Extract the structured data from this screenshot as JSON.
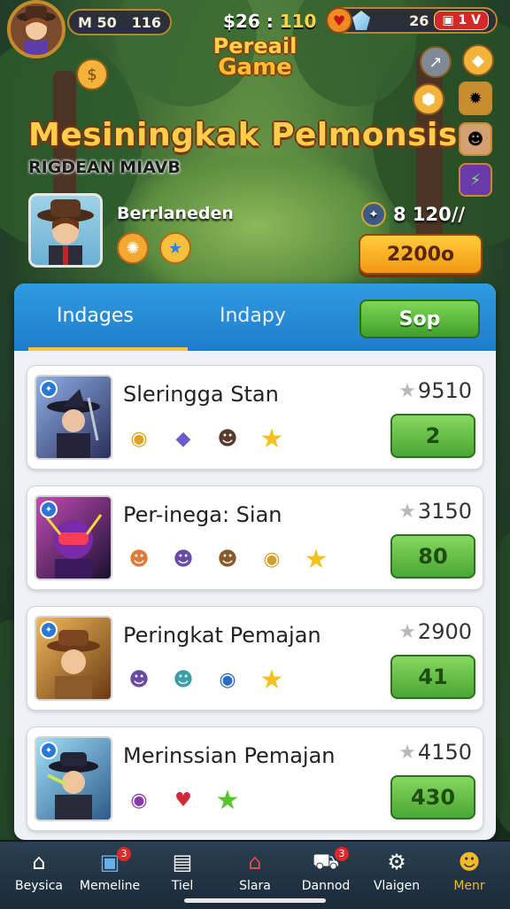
{
  "header": {
    "left_pill_label": "M 50",
    "left_pill_value": "116",
    "money_prefix": "$26 :",
    "money_value": "110",
    "gems_value": "26",
    "right_badge": "1 V"
  },
  "logo": {
    "line1": "Pereail",
    "line2": "Game"
  },
  "title": "Mesiningkak Pelmonsis",
  "subtitle": "RIGDEAN MIAVB",
  "player": {
    "name": "Berrlaneden",
    "stat_value": "8 120//",
    "gold_button": "2200o"
  },
  "tabs": {
    "tab1": "Indages",
    "tab2": "Indapy",
    "action_button": "Sop"
  },
  "rows": [
    {
      "name": "Sleringga Stan",
      "score": "9510",
      "button": "2",
      "thumb_colors": [
        "#6b8fd4",
        "#2a2f5a"
      ]
    },
    {
      "name": "Per-inega: Sian",
      "score": "3150",
      "button": "80",
      "thumb_colors": [
        "#b23aa8",
        "#1a1030"
      ]
    },
    {
      "name": "Peringkat Pemajan",
      "score": "2900",
      "button": "41",
      "thumb_colors": [
        "#e0a24a",
        "#6a3a14"
      ]
    },
    {
      "name": "Merinssian Pemajan",
      "score": "4150",
      "button": "430",
      "thumb_colors": [
        "#7ad0f0",
        "#2e5a8a"
      ]
    }
  ],
  "nav": [
    {
      "label": "Beysica",
      "icon": "home-icon"
    },
    {
      "label": "Memeline",
      "icon": "gift-icon",
      "badge": "3"
    },
    {
      "label": "Tiel",
      "icon": "card-icon"
    },
    {
      "label": "Slara",
      "icon": "shop-icon"
    },
    {
      "label": "Dannod",
      "icon": "cart-icon",
      "badge": "3"
    },
    {
      "label": "Vlaigen",
      "icon": "gear-icon"
    },
    {
      "label": "Menr",
      "icon": "profile-icon"
    }
  ],
  "colors": {
    "accent_gold": "#ffcf4a",
    "tab_blue": "#1f7dcc",
    "green_button": "#4aa633"
  }
}
